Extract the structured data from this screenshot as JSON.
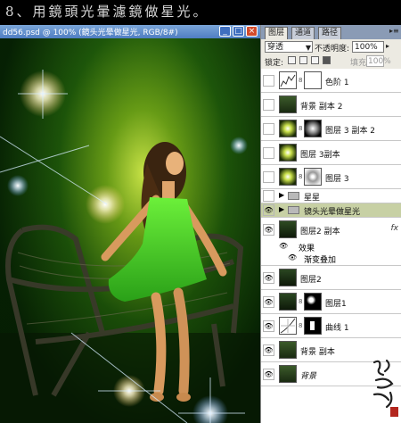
{
  "header": {
    "title": "8、用鏡頭光暈濾鏡做星光。"
  },
  "document": {
    "title": "dd56.psd @ 100% (鏡头光晕做星光, RGB/8#)",
    "buttons": {
      "minimize": "_",
      "maximize": "□",
      "close": "×"
    }
  },
  "panel": {
    "tabs": [
      "图层",
      "通道",
      "路径"
    ],
    "menu_icon": "triangle-menu-icon",
    "blend_mode": "穿透",
    "opacity_label": "不透明度:",
    "opacity_value": "100%",
    "lock_label": "锁定:",
    "fill_label": "填充:",
    "fill_value": "100%",
    "layers": [
      {
        "name": "色阶 1",
        "eye": false,
        "thumb": "levels-adjustment",
        "mask": true
      },
      {
        "name": "背景 副本 2",
        "eye": false,
        "thumb": "photo"
      },
      {
        "name": "图层 3 副本 2",
        "eye": false,
        "thumb": "flare",
        "mask": true
      },
      {
        "name": "图层 3副本",
        "eye": false,
        "thumb": "flare"
      },
      {
        "name": "图层 3",
        "eye": false,
        "thumb": "flare",
        "mask": true
      },
      {
        "name": "星星",
        "eye": false,
        "group": true
      },
      {
        "name": "镜头光晕做星光",
        "eye": true,
        "group": true,
        "selected": true
      },
      {
        "name": "图层2 副本",
        "eye": true,
        "thumb": "photo",
        "fx": "fx"
      },
      {
        "name": "图层2",
        "eye": true,
        "thumb": "photo"
      },
      {
        "name": "图层1",
        "eye": true,
        "thumb": "photo",
        "mask": true
      },
      {
        "name": "曲线 1",
        "eye": true,
        "thumb": "curves-adjustment",
        "mask": true
      },
      {
        "name": "背景 副本",
        "eye": true,
        "thumb": "photo"
      },
      {
        "name": "背景",
        "eye": true,
        "thumb": "photo"
      }
    ],
    "effects": {
      "label": "效果",
      "item": "渐变叠加"
    }
  },
  "colors": {
    "panel_bg": "#eceae2",
    "selected_row": "#c7d0a4",
    "titlebar": "#4f7dc2"
  }
}
